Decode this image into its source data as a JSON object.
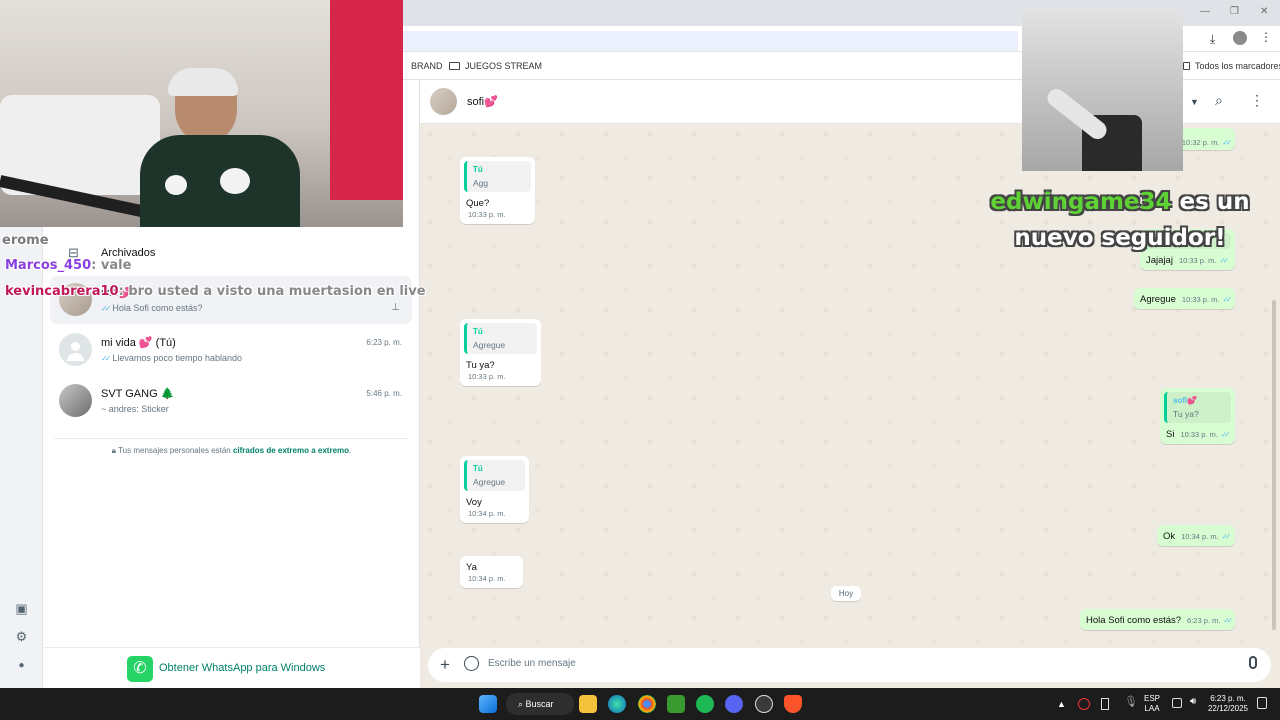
{
  "browser": {
    "bookmarks": [
      "BRAND",
      "JUEGOS STREAM"
    ],
    "all_bookmarks": "Todos los marcadores",
    "window_controls": [
      "—",
      "❐",
      "✕"
    ]
  },
  "sidebar": {
    "archived_label": "Archivados",
    "chats": [
      {
        "name": "sofi💕",
        "time": "",
        "preview": "Hola Sofi como estás?",
        "pinned": true
      },
      {
        "name": "mi vida 💕 (Tú)",
        "time": "6:23 p. m.",
        "preview": "Llevamos poco tiempo hablando"
      },
      {
        "name": "SVT GANG 🌲",
        "time": "5:46 p. m.",
        "preview": "~ andres: Sticker"
      }
    ],
    "e2e_text": "Tus mensajes personales están ",
    "e2e_link": "cifrados de extremo a extremo",
    "e2e_end": ".",
    "get_app": "Obtener WhatsApp para Windows"
  },
  "header": {
    "contact_name": "sofi💕"
  },
  "conversation": {
    "messages": [
      {
        "dir": "in",
        "quote_name": "Tú",
        "quote_text": "Agg",
        "text": "Que?",
        "time": "10:33 p. m."
      },
      {
        "dir": "out",
        "text": "",
        "time": "10:32 p. m."
      },
      {
        "dir": "out",
        "quote_name": "",
        "quote_text": "Que?",
        "text": "Jajajaj",
        "time": "10:33 p. m."
      },
      {
        "dir": "out",
        "text": "Agregue",
        "time": "10:33 p. m."
      },
      {
        "dir": "in",
        "quote_name": "Tú",
        "quote_text": "Agregue",
        "text": "Tu ya?",
        "time": "10:33 p. m."
      },
      {
        "dir": "out",
        "quote_name": "sofi💕",
        "quote_text": "Tu ya?",
        "text": "Si",
        "time": "10:33 p. m."
      },
      {
        "dir": "in",
        "quote_name": "Tú",
        "quote_text": "Agregue",
        "text": "Voy",
        "time": "10:34 p. m."
      },
      {
        "dir": "out",
        "text": "Ok",
        "time": "10:34 p. m."
      },
      {
        "dir": "in",
        "text": "Ya",
        "time": "10:34 p. m."
      },
      {
        "dir": "out",
        "text": "Hola Sofi como estás?",
        "time": "6:23 p. m."
      }
    ],
    "date_divider": "Hoy"
  },
  "composer": {
    "placeholder": "Escribe un mensaje"
  },
  "stream_overlay": {
    "chat_lines": [
      {
        "user": "",
        "message": "erome",
        "user_color": "#7a3fd1"
      },
      {
        "user": "Marcos_450",
        "message": ": vale",
        "user_color": "#8a3fe0"
      },
      {
        "user": "kevincabrera10",
        "message": ": bro usted a visto una muertasion en live",
        "user_color": "#c0185a"
      }
    ],
    "follow_user": "edwingame34",
    "follow_text": " es un nuevo seguidor!"
  },
  "taskbar": {
    "search_label": "Buscar",
    "language": "ESP",
    "layout": "LAA",
    "time": "6:23 p. m.",
    "date": "22/12/2025"
  },
  "colors": {
    "accent": "#25d366",
    "outgoing_bubble": "#d9fdd3",
    "wallpaper": "#efeae2",
    "read_tick": "#53bdeb"
  }
}
